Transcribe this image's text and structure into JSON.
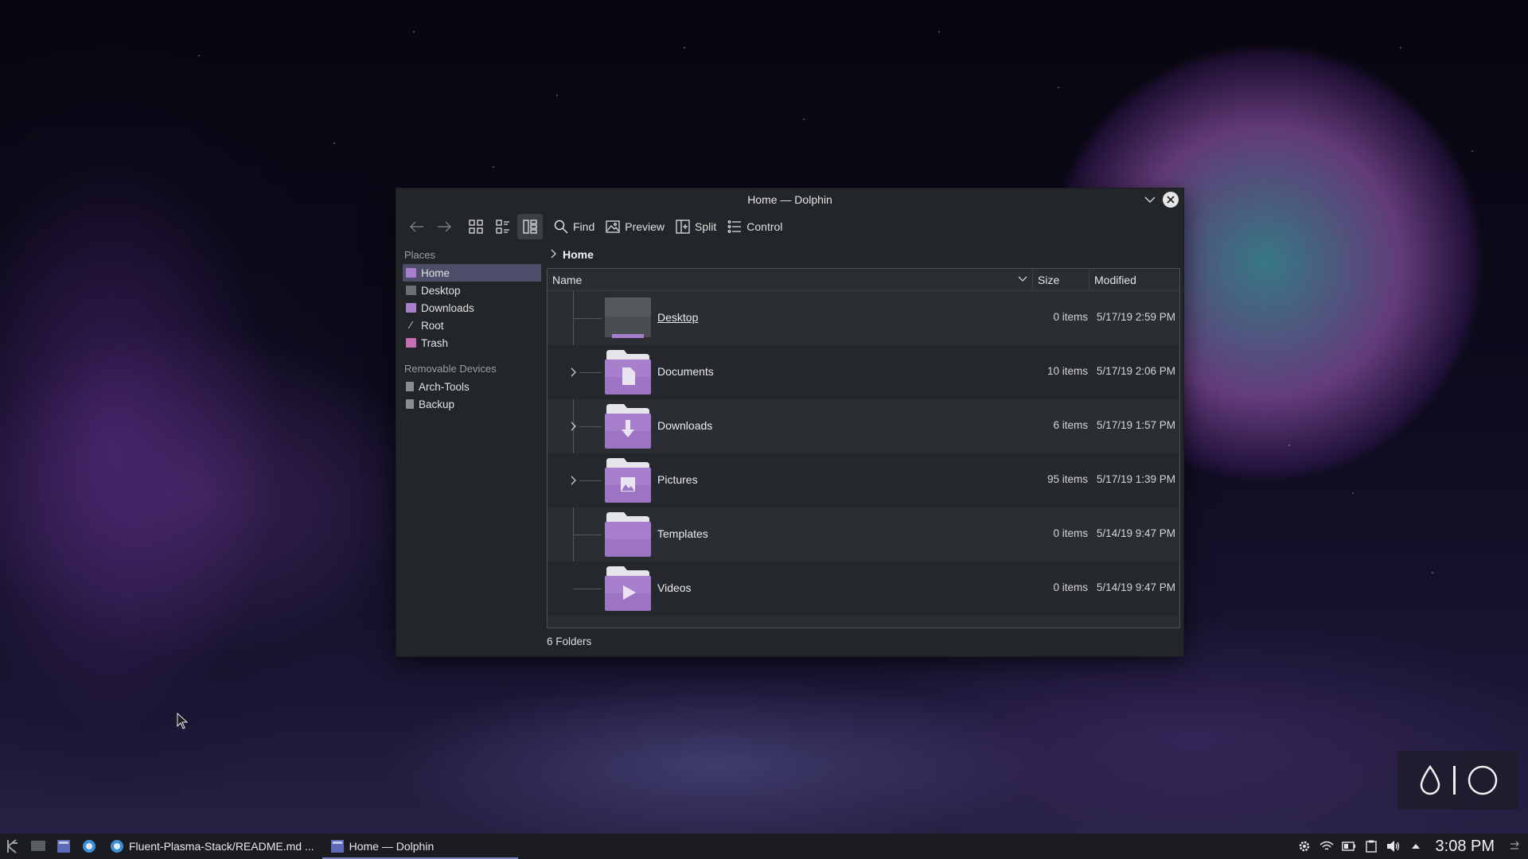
{
  "window": {
    "title": "Home — Dolphin"
  },
  "toolbar": {
    "find_label": "Find",
    "preview_label": "Preview",
    "split_label": "Split",
    "control_label": "Control"
  },
  "places": {
    "title": "Places",
    "items": [
      {
        "label": "Home",
        "icon": "folder-home-icon",
        "selected": true
      },
      {
        "label": "Desktop",
        "icon": "desktop-icon"
      },
      {
        "label": "Downloads",
        "icon": "folder-downloads-icon"
      },
      {
        "label": "Root",
        "icon": "root-icon"
      },
      {
        "label": "Trash",
        "icon": "trash-icon"
      }
    ]
  },
  "removable": {
    "title": "Removable Devices",
    "items": [
      {
        "label": "Arch-Tools",
        "icon": "drive-icon"
      },
      {
        "label": "Backup",
        "icon": "drive-icon"
      }
    ]
  },
  "breadcrumb": {
    "current": "Home"
  },
  "columns": {
    "name": "Name",
    "size": "Size",
    "modified": "Modified"
  },
  "files": [
    {
      "name": "Desktop",
      "size": "0 items",
      "modified": "5/17/19 2:59 PM",
      "icon": "desktop-folder-icon",
      "expandable": false
    },
    {
      "name": "Documents",
      "size": "10 items",
      "modified": "5/17/19 2:06 PM",
      "icon": "folder-documents-icon",
      "expandable": true
    },
    {
      "name": "Downloads",
      "size": "6 items",
      "modified": "5/17/19 1:57 PM",
      "icon": "folder-downloads-icon",
      "expandable": true
    },
    {
      "name": "Pictures",
      "size": "95 items",
      "modified": "5/17/19 1:39 PM",
      "icon": "folder-pictures-icon",
      "expandable": true
    },
    {
      "name": "Templates",
      "size": "0 items",
      "modified": "5/14/19 9:47 PM",
      "icon": "folder-templates-icon",
      "expandable": false
    },
    {
      "name": "Videos",
      "size": "0 items",
      "modified": "5/14/19 9:47 PM",
      "icon": "folder-videos-icon",
      "expandable": false
    }
  ],
  "status": {
    "text": "6 Folders"
  },
  "taskbar": {
    "tasks": [
      {
        "label": "Fluent-Plasma-Stack/README.md ...",
        "icon": "browser-icon"
      },
      {
        "label": "Home — Dolphin",
        "icon": "dolphin-icon",
        "active": true
      }
    ],
    "clock": "3:08 PM"
  },
  "colors": {
    "accent": "#a77fcc",
    "window_bg": "#232629",
    "selection": "#4d4f6a"
  }
}
